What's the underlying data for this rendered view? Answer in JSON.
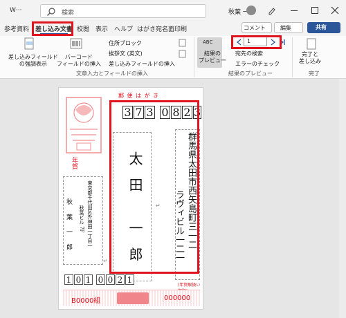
{
  "title": {
    "doc": "W···",
    "search_placeholder": "検索",
    "user": "秋葉 一郎"
  },
  "tabs": [
    "参考資料",
    "差し込み文書",
    "校閲",
    "表示",
    "ヘルプ",
    "はがき宛名面印刷"
  ],
  "actions": {
    "comment": "コメント",
    "edit": "編集",
    "share": "共有"
  },
  "ribbon": {
    "highlight_fields": "差し込みフィールド\nの強調表示",
    "barcode": "バーコード\nフィールドの挿入",
    "address_block": "住所ブロック",
    "greeting": "挨拶文 (英文)",
    "insert_field": "差し込みフィールドの挿入",
    "group1": "文章入力とフィールドの挿入",
    "preview": "結果の\nプレビュー",
    "preview_abc": "ABC",
    "record": "1",
    "find": "宛先の検索",
    "check": "エラーのチェック",
    "group2": "結果のプレビュー",
    "finish": "完了と\n差し込み",
    "group3": "完了"
  },
  "postcard": {
    "header": "郵 便 は が き",
    "zip": [
      "3",
      "7",
      "3",
      "0",
      "8",
      "2",
      "3"
    ],
    "address_line1": "群馬県太田市西矢島町三一二",
    "address_line2": "ラヴィビル一二一",
    "name": "太田 一郎 様",
    "sender_zip": [
      "1",
      "0",
      "1",
      "0",
      "0",
      "2",
      "1"
    ],
    "sender_address": "東京都千代田区外神田一丁目一",
    "sender_company": "秋葉ビル 7F",
    "sender_name": "秋 葉 一 郎",
    "footer_left": "B0000組",
    "footer_right": "000000",
    "stamp_label": "年賀",
    "small_print": "(年賀取扱い期限)"
  }
}
